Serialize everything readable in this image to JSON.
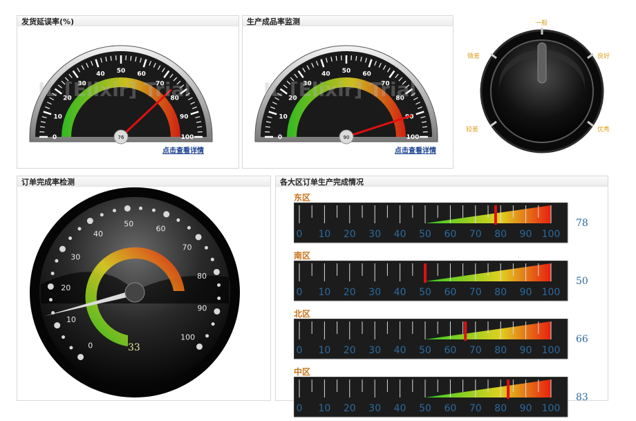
{
  "panels": {
    "delay": {
      "title": "发货延误率(%)",
      "value": 76,
      "link": "点击查看详情",
      "ticks": [
        "0",
        "10",
        "20",
        "30",
        "40",
        "50",
        "60",
        "70",
        "80",
        "90",
        "100"
      ]
    },
    "quality": {
      "title": "生产成品率监测",
      "value": 90,
      "link": "点击查看详情",
      "ticks": [
        "0",
        "10",
        "20",
        "30",
        "40",
        "50",
        "60",
        "70",
        "80",
        "90",
        "100"
      ]
    },
    "knob": {
      "labels": [
        "一般",
        "良好",
        "优秀",
        "较差",
        "微差"
      ]
    },
    "order": {
      "title": "订单完成率检测",
      "value": "33",
      "ticks": [
        "0",
        "10",
        "20",
        "30",
        "40",
        "50",
        "60",
        "70",
        "80",
        "90",
        "100"
      ]
    },
    "regions": {
      "title": "各大区订单生产完成情况",
      "scale": [
        "0",
        "10",
        "20",
        "30",
        "40",
        "50",
        "60",
        "70",
        "80",
        "90",
        "100"
      ],
      "items": [
        {
          "name": "东区",
          "value": "78"
        },
        {
          "name": "南区",
          "value": "50"
        },
        {
          "name": "北区",
          "value": "66"
        },
        {
          "name": "中区",
          "value": "83"
        }
      ]
    }
  },
  "watermark": "IL [Elixir] Trial",
  "colors": {
    "needle": "#e01010",
    "link": "#1a3f8f",
    "region": "#c8741a",
    "value": "#2a6aa0"
  }
}
